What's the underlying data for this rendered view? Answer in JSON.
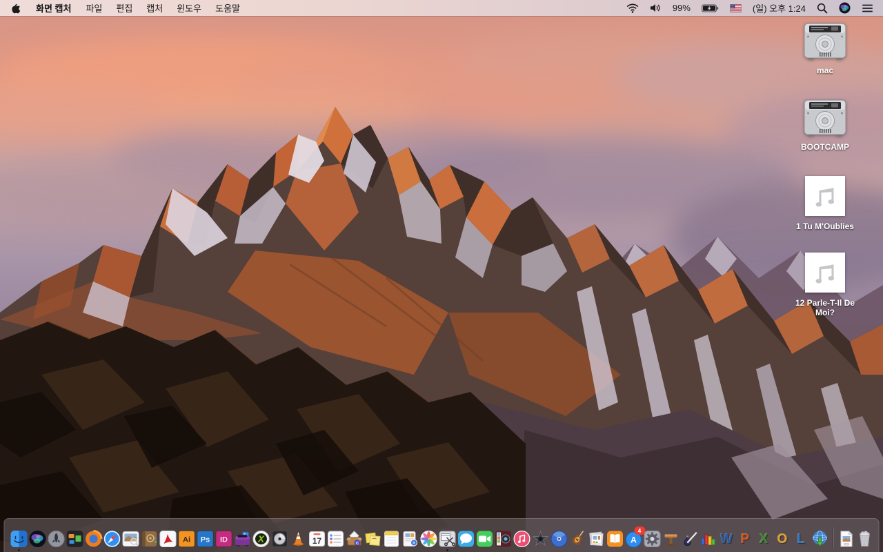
{
  "menu_bar": {
    "left": {
      "apple_icon": "apple-logo",
      "app_name": "화면 캡처",
      "menus": [
        "파일",
        "편집",
        "캡처",
        "윈도우",
        "도움말"
      ]
    },
    "right": [
      {
        "type": "icon",
        "name": "wifi-icon",
        "art": "wifi"
      },
      {
        "type": "icon",
        "name": "volume-icon",
        "art": "volume"
      },
      {
        "type": "text",
        "name": "battery-percent",
        "value": "99%"
      },
      {
        "type": "icon",
        "name": "battery-charging-icon",
        "art": "battery"
      },
      {
        "type": "icon",
        "name": "input-source-us-flag-icon",
        "art": "flag"
      },
      {
        "type": "text",
        "name": "menu-bar-clock",
        "value": "(일) 오후 1:24"
      },
      {
        "type": "icon",
        "name": "spotlight-search-icon",
        "art": "spotlight"
      },
      {
        "type": "icon",
        "name": "siri-icon",
        "art": "siri"
      },
      {
        "type": "icon",
        "name": "notification-center-icon",
        "art": "notif"
      }
    ]
  },
  "desktop": {
    "icons": [
      {
        "name": "drive-mac",
        "type": "drive",
        "label": "mac"
      },
      {
        "name": "drive-bootcamp",
        "type": "drive",
        "label": "BOOTCAMP"
      },
      {
        "name": "audio-file-1",
        "type": "audio",
        "label": "1 Tu M'Oublies"
      },
      {
        "name": "audio-file-12",
        "type": "audio",
        "label": "12 Parle-T-Il De Moi?"
      }
    ]
  },
  "dock": {
    "apps": [
      {
        "name": "finder",
        "art": "finder",
        "running": true
      },
      {
        "name": "siri",
        "art": "siri"
      },
      {
        "name": "launchpad",
        "art": "launchpad"
      },
      {
        "name": "mission-control",
        "art": "mission"
      },
      {
        "name": "firefox",
        "art": "firefox"
      },
      {
        "name": "safari",
        "art": "safari"
      },
      {
        "name": "preview",
        "art": "preview"
      },
      {
        "name": "contacts-book",
        "art": "book"
      },
      {
        "name": "adobe-reader",
        "art": "acrobat"
      },
      {
        "name": "illustrator",
        "art": "tile",
        "glyph": "Ai",
        "bg": "#f29423",
        "fg": "#3a2806"
      },
      {
        "name": "photoshop",
        "art": "tile",
        "glyph": "Ps",
        "bg": "#2677c9",
        "fg": "#e3f1ff"
      },
      {
        "name": "indesign",
        "art": "tile",
        "glyph": "ID",
        "bg": "#c52b80",
        "fg": "#ffd9ee"
      },
      {
        "name": "toast",
        "art": "toast"
      },
      {
        "name": "x-utility",
        "art": "xutil"
      },
      {
        "name": "disc-utility",
        "art": "disc"
      },
      {
        "name": "vlc",
        "art": "vlc"
      },
      {
        "name": "calendar",
        "art": "calendar",
        "day": "17"
      },
      {
        "name": "reminders",
        "art": "reminders"
      },
      {
        "name": "stuffit-expander",
        "art": "stuffit"
      },
      {
        "name": "stickies",
        "art": "stickies"
      },
      {
        "name": "notepad",
        "art": "notepad"
      },
      {
        "name": "installer",
        "art": "installer"
      },
      {
        "name": "photos",
        "art": "photos"
      },
      {
        "name": "grab-screen-capture",
        "art": "grab",
        "running": true
      },
      {
        "name": "messages",
        "art": "messages"
      },
      {
        "name": "facetime",
        "art": "facetime"
      },
      {
        "name": "photo-booth",
        "art": "photobooth"
      },
      {
        "name": "itunes",
        "art": "itunes"
      },
      {
        "name": "imovie",
        "art": "imovie"
      },
      {
        "name": "idvd",
        "art": "idvd"
      },
      {
        "name": "garageband",
        "art": "garageband"
      },
      {
        "name": "iweb",
        "art": "iweb"
      },
      {
        "name": "ibooks",
        "art": "ibooks"
      },
      {
        "name": "app-store",
        "art": "appstore",
        "badge": "4"
      },
      {
        "name": "system-preferences",
        "art": "sysprefs"
      },
      {
        "name": "keynote",
        "art": "keynote"
      },
      {
        "name": "pages",
        "art": "pages"
      },
      {
        "name": "microsoft-office",
        "art": "msbars"
      },
      {
        "name": "word",
        "art": "letter",
        "glyph": "W",
        "fg": "#2b5ca8"
      },
      {
        "name": "powerpoint",
        "art": "letter",
        "glyph": "P",
        "fg": "#d0541f"
      },
      {
        "name": "excel",
        "art": "letter",
        "glyph": "X",
        "fg": "#3f8c2f"
      },
      {
        "name": "outlook",
        "art": "letter",
        "glyph": "O",
        "fg": "#e0a12f"
      },
      {
        "name": "lync",
        "art": "letter",
        "glyph": "L",
        "fg": "#2e7cc4"
      },
      {
        "name": "document-connection",
        "art": "globe"
      }
    ],
    "documents": [
      {
        "name": "document-file",
        "art": "docfile"
      }
    ],
    "trash": {
      "name": "trash",
      "art": "trash"
    }
  }
}
